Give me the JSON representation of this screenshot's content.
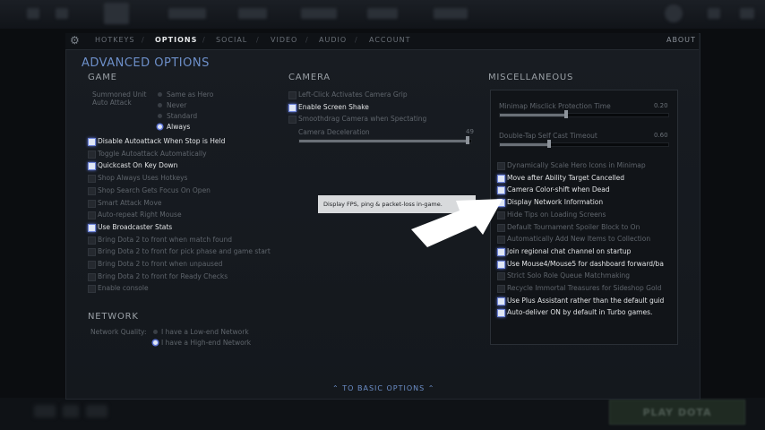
{
  "tabs": [
    "HOTKEYS",
    "OPTIONS",
    "SOCIAL",
    "VIDEO",
    "AUDIO",
    "ACCOUNT"
  ],
  "about": "ABOUT",
  "title": "ADVANCED OPTIONS",
  "game": {
    "heading": "GAME",
    "summoned_label_1": "Summoned Unit",
    "summoned_label_2": "Auto Attack",
    "radios": [
      "Same as Hero",
      "Never",
      "Standard",
      "Always"
    ],
    "options": [
      {
        "label": "Disable Autoattack When Stop is Held",
        "checked": true
      },
      {
        "label": "Toggle Autoattack Automatically",
        "checked": false
      },
      {
        "label": "Quickcast On Key Down",
        "checked": true
      },
      {
        "label": "Shop Always Uses Hotkeys",
        "checked": false
      },
      {
        "label": "Shop Search Gets Focus On Open",
        "checked": false
      },
      {
        "label": "Smart Attack Move",
        "checked": false
      },
      {
        "label": "Auto-repeat Right Mouse",
        "checked": false
      },
      {
        "label": "Use Broadcaster Stats",
        "checked": true
      },
      {
        "label": "Bring Dota 2 to front when match found",
        "checked": false
      },
      {
        "label": "Bring Dota 2 to front for pick phase and game start",
        "checked": false
      },
      {
        "label": "Bring Dota 2 to front when unpaused",
        "checked": false
      },
      {
        "label": "Bring Dota 2 to front for Ready Checks",
        "checked": false
      },
      {
        "label": "Enable console",
        "checked": false
      }
    ]
  },
  "network": {
    "heading": "NETWORK",
    "quality_label": "Network Quality:",
    "radios": [
      "I have a Low-end Network",
      "I have a High-end Network"
    ]
  },
  "camera": {
    "heading": "CAMERA",
    "options": [
      {
        "label": "Left-Click Activates Camera Grip",
        "checked": false
      },
      {
        "label": "Enable Screen Shake",
        "checked": true
      },
      {
        "label": "Smoothdrag Camera when Spectating",
        "checked": false
      }
    ],
    "decel_label": "Camera Deceleration",
    "decel_value": "49"
  },
  "misc": {
    "heading": "MISCELLANEOUS",
    "minimap_label": "Minimap Misclick Protection Time",
    "minimap_value": "0.20",
    "doubletap_label": "Double-Tap Self Cast Timeout",
    "doubletap_value": "0.60",
    "options": [
      {
        "label": "Dynamically Scale Hero Icons in Minimap",
        "checked": false
      },
      {
        "label": "Move after Ability Target Cancelled",
        "checked": true
      },
      {
        "label": "Camera Color-shift when Dead",
        "checked": true
      },
      {
        "label": "Display Network Information",
        "checked": true
      },
      {
        "label": "Hide Tips on Loading Screens",
        "checked": false
      },
      {
        "label": "Default Tournament Spoiler Block to On",
        "checked": false
      },
      {
        "label": "Automatically Add New Items to Collection",
        "checked": false
      },
      {
        "label": "Join regional chat channel on startup",
        "checked": true
      },
      {
        "label": "Use Mouse4/Mouse5 for dashboard forward/ba",
        "checked": true
      },
      {
        "label": "Strict Solo Role Queue Matchmaking",
        "checked": false
      },
      {
        "label": "Recycle Immortal Treasures for Sideshop Gold",
        "checked": false
      },
      {
        "label": "Use Plus Assistant rather than the default guid",
        "checked": true
      },
      {
        "label": "Auto-deliver ON by default in Turbo games.",
        "checked": true
      }
    ]
  },
  "tooltip": "Display FPS, ping & packet-loss in-game.",
  "basic_link": "TO BASIC OPTIONS",
  "play_button": "PLAY DOTA",
  "colors": {
    "accent": "#6d8fc9",
    "checkbox_on": "#5d74d6"
  }
}
